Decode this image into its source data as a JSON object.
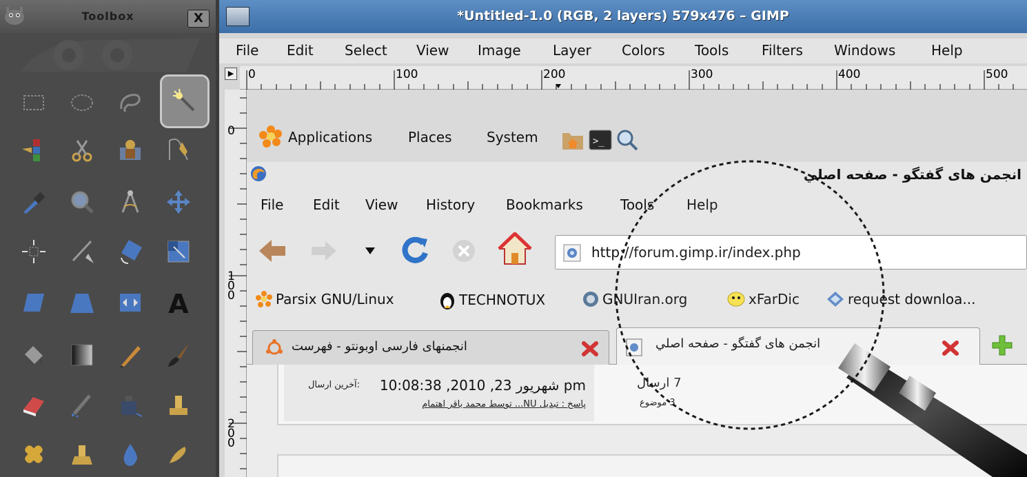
{
  "toolbox": {
    "title": "Toolbox",
    "close_label": "X",
    "tools": [
      "rect-select-icon",
      "ellipse-select-icon",
      "free-select-icon",
      "fuzzy-select-icon",
      "select-by-color-icon",
      "scissors-select-icon",
      "foreground-select-icon",
      "paths-icon",
      "color-picker-icon",
      "zoom-icon",
      "measure-icon",
      "move-icon",
      "align-icon",
      "crop-icon",
      "rotate-icon",
      "scale-icon",
      "shear-icon",
      "perspective-icon",
      "flip-icon",
      "text-icon",
      "bucket-fill-icon",
      "blend-icon",
      "pencil-icon",
      "paintbrush-icon",
      "eraser-icon",
      "airbrush-icon",
      "ink-icon",
      "clone-icon",
      "heal-icon",
      "perspective-clone-icon",
      "blur-icon",
      "smudge-icon"
    ],
    "active_tool": "fuzzy-select-icon"
  },
  "gimp": {
    "title": "*Untitled-1.0 (RGB, 2 layers) 579x476 – GIMP",
    "menu": [
      "File",
      "Edit",
      "Select",
      "View",
      "Image",
      "Layer",
      "Colors",
      "Tools",
      "Filters",
      "Windows",
      "Help"
    ],
    "hruler": [
      "0",
      "100",
      "200",
      "300",
      "400",
      "500"
    ],
    "vruler": [
      "0",
      "1\n0\n0",
      "2\n0\n0"
    ]
  },
  "panel": {
    "applications": "Applications",
    "places": "Places",
    "system": "System"
  },
  "firefox": {
    "title": "انجمن های گفتگو - صفحه اصلي",
    "menu": [
      "File",
      "Edit",
      "View",
      "History",
      "Bookmarks",
      "Tools",
      "Help"
    ],
    "url": "http://forum.gimp.ir/index.php",
    "bookmarks": [
      "Parsix GNU/Linux",
      "TECHNOTUX",
      "GNUIran.org",
      "xFarDic",
      "request downloa..."
    ],
    "tabs": [
      {
        "label": "انجمنهای فارسی اوبونتو - فهرست"
      },
      {
        "label": "انجمن های گفتگو - صفحه اصلي"
      }
    ]
  },
  "forum": {
    "last_post_prefix": "آخرین ارسال:",
    "last_post_date": "شهریور 23, 2010, 10:08:38 pm",
    "reply_line": "پاسخ : تبدیل NU... توسط محمد باقر اهتمام",
    "posts": "7 ارسال",
    "topics": "3 موضوع"
  }
}
